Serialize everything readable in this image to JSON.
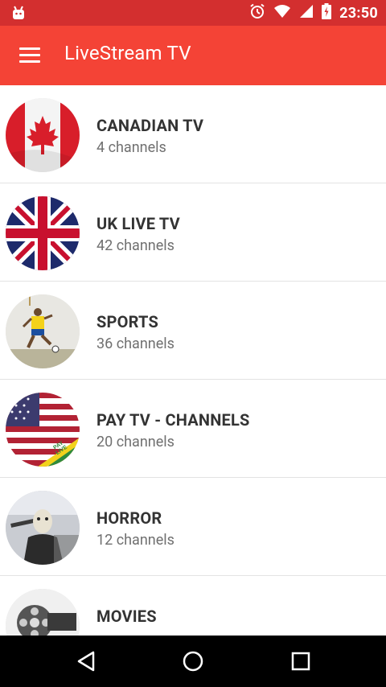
{
  "status_bar": {
    "time": "23:50",
    "icons": [
      "android-icon",
      "alarm-icon",
      "wifi-icon",
      "signal-icon",
      "battery-icon"
    ]
  },
  "app_bar": {
    "title": "LiveStream TV",
    "menu_icon": "menu-icon"
  },
  "categories": [
    {
      "title": "CANADIAN TV",
      "count": "4 channels",
      "thumb": "canada-flag"
    },
    {
      "title": "UK LIVE TV",
      "count": "42 channels",
      "thumb": "uk-flag"
    },
    {
      "title": "SPORTS",
      "count": "36 channels",
      "thumb": "soccer-player"
    },
    {
      "title": "PAY TV - CHANNELS",
      "count": "20 channels",
      "thumb": "us-flag-pay-live"
    },
    {
      "title": "HORROR",
      "count": "12 channels",
      "thumb": "horror-mask"
    },
    {
      "title": "MOVIES",
      "count": "",
      "thumb": "film-reel"
    }
  ],
  "thumb_texts": {
    "pay_badge_1": "PAY",
    "pay_badge_2": "LIVE"
  },
  "nav_bar": {
    "icons": [
      "back-icon",
      "home-icon",
      "recents-icon"
    ]
  },
  "colors": {
    "status_bar": "#d32f2f",
    "app_bar": "#f44336",
    "nav_bar": "#000000"
  }
}
